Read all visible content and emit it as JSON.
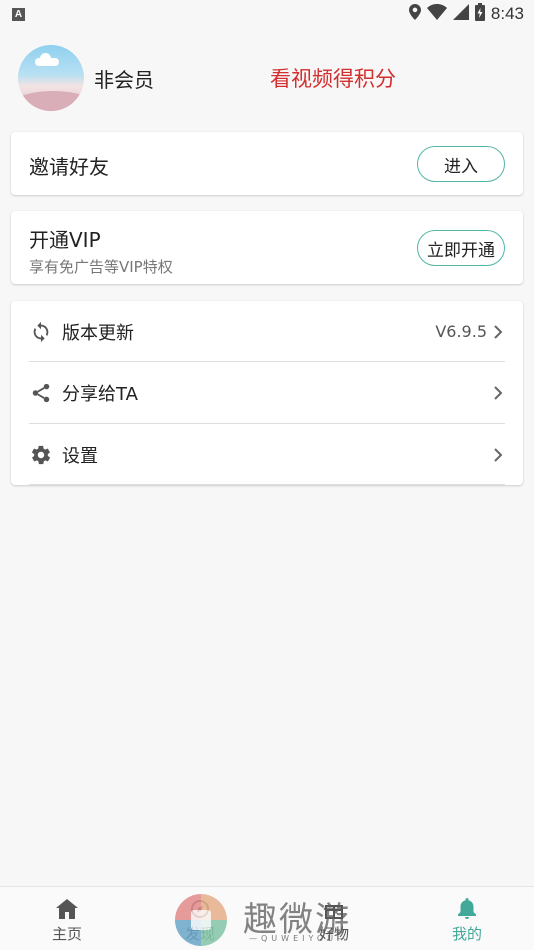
{
  "status_bar": {
    "notification_glyph": "A",
    "time": "8:43",
    "icons": [
      "location-icon",
      "wifi-icon",
      "signal-icon",
      "battery-icon"
    ]
  },
  "profile": {
    "member_status": "非会员",
    "earn_points_link": "看视频得积分"
  },
  "invite": {
    "title": "邀请好友",
    "button_label": "进入"
  },
  "vip": {
    "title": "开通VIP",
    "subtitle": "享有免广告等VIP特权",
    "button_label": "立即开通"
  },
  "menu": {
    "update_label": "版本更新",
    "version": "V6.9.5",
    "share_label": "分享给TA",
    "settings_label": "设置"
  },
  "bottom_nav": {
    "home": "主页",
    "discover": "发现",
    "goods": "好物",
    "mine": "我的"
  },
  "watermark": {
    "text": "趣微游",
    "sub": "—QUWEIYOU—"
  },
  "colors": {
    "accent": "#42a89a",
    "button_border": "#52b6a6",
    "promo_red": "#d32f2f"
  }
}
